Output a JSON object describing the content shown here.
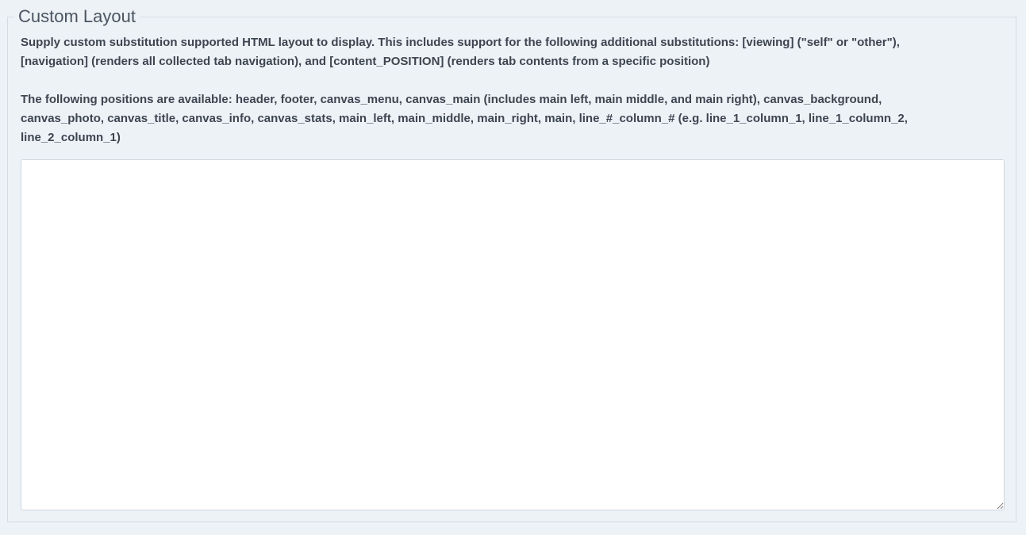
{
  "section": {
    "legend": "Custom Layout",
    "help_line_1": "Supply custom substitution supported HTML layout to display. This includes support for the following additional substitutions: [viewing] (\"self\" or \"other\"), [navigation] (renders all collected tab navigation), and [content_POSITION] (renders tab contents from a specific position)",
    "help_line_2": "The following positions are available: header, footer, canvas_menu, canvas_main (includes main left, main middle, and main right), canvas_background, canvas_photo, canvas_title, canvas_info, canvas_stats, main_left, main_middle, main_right, main, line_#_column_# (e.g. line_1_column_1, line_1_column_2, line_2_column_1)"
  },
  "layout_field": {
    "value": ""
  }
}
